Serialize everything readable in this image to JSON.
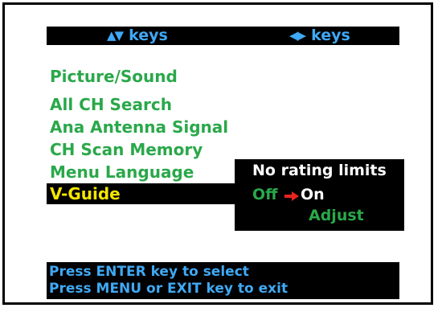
{
  "header": {
    "vertical_keys_label": "keys",
    "horizontal_keys_label": "keys"
  },
  "menu": {
    "items": [
      {
        "label": "Picture/Sound"
      },
      {
        "label": "All CH Search"
      },
      {
        "label": "Ana Antenna Signal"
      },
      {
        "label": "CH Scan Memory"
      },
      {
        "label": "Menu Language"
      },
      {
        "label": "V-Guide",
        "selected": true
      }
    ]
  },
  "submenu": {
    "title": "No rating limits",
    "option_off": "Off",
    "option_on": "On",
    "adjust": "Adjust",
    "current_value": "On"
  },
  "footer": {
    "line1": "Press ENTER key to select",
    "line2": "Press MENU or EXIT key to exit"
  },
  "colors": {
    "background": "#ffffff",
    "panel": "#000000",
    "menu_text": "#2aa84a",
    "selected_text": "#f5e600",
    "hint_text": "#3fa9f5",
    "white_text": "#ffffff",
    "arrow": "#e8231f"
  },
  "icons": {
    "vertical_keys": "up-down-arrows-icon",
    "horizontal_keys": "left-right-arrows-icon",
    "selection_pointer": "red-arrow-icon"
  }
}
